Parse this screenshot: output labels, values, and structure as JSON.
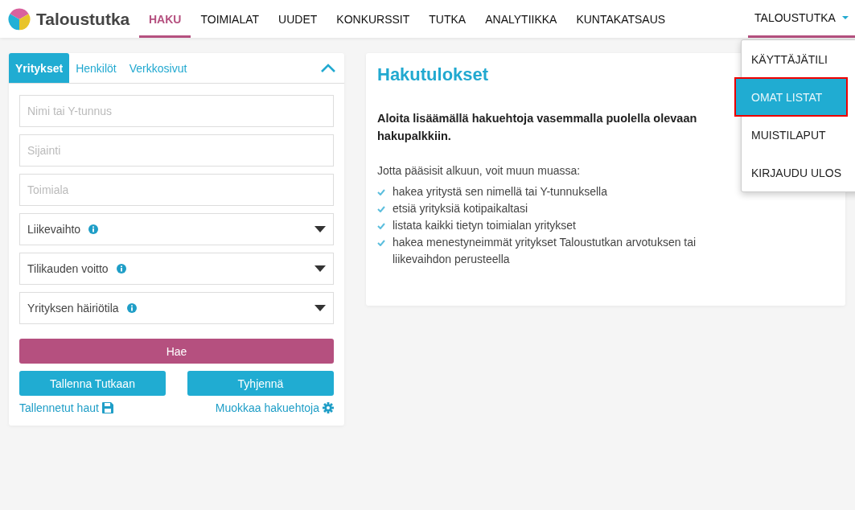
{
  "brand": {
    "name": "Taloustutka"
  },
  "nav": [
    {
      "label": "HAKU",
      "selected": true
    },
    {
      "label": "TOIMIALAT",
      "selected": false
    },
    {
      "label": "UUDET",
      "selected": false
    },
    {
      "label": "KONKURSSIT",
      "selected": false
    },
    {
      "label": "TUTKA",
      "selected": false
    },
    {
      "label": "ANALYTIIKKA",
      "selected": false
    },
    {
      "label": "KUNTAKATSAUS",
      "selected": false
    }
  ],
  "user_menu": {
    "label": "TALOUSTUTKA",
    "expanded": true,
    "items": [
      {
        "label": "KÄYTTÄJÄTILI",
        "selected": false,
        "highlighted": false
      },
      {
        "label": "OMAT LISTAT",
        "selected": true,
        "highlighted": true
      },
      {
        "label": "MUISTILAPUT",
        "selected": false,
        "highlighted": false
      },
      {
        "label": "KIRJAUDU ULOS",
        "selected": false,
        "highlighted": false
      }
    ]
  },
  "search_panel": {
    "tabs": [
      {
        "label": "Yritykset",
        "selected": true
      },
      {
        "label": "Henkilöt",
        "selected": false
      },
      {
        "label": "Verkkosivut",
        "selected": false
      }
    ],
    "collapsed": false,
    "fields": [
      {
        "kind": "text",
        "placeholder": "Nimi tai Y-tunnus"
      },
      {
        "kind": "text",
        "placeholder": "Sijainti"
      },
      {
        "kind": "text",
        "placeholder": "Toimiala"
      },
      {
        "kind": "select",
        "label": "Liikevaihto"
      },
      {
        "kind": "select",
        "label": "Tilikauden voitto"
      },
      {
        "kind": "select",
        "label": "Yrityksen häiriötila"
      }
    ],
    "search_button": "Hae",
    "save_button": "Tallenna Tutkaan",
    "clear_button": "Tyhjennä",
    "saved_link": "Tallennetut haut",
    "edit_link": "Muokkaa hakuehtoja"
  },
  "results": {
    "title": "Hakutulokset",
    "lead": "Aloita lisäämällä hakuehtoja vasemmalla puolella olevaan hakupalkkiin.",
    "intro": "Jotta pääsisit alkuun, voit muun muassa:",
    "tips": [
      "hakea yritystä sen nimellä tai Y-tunnuksella",
      "etsiä yrityksiä kotipaikaltasi",
      "listata kaikki tietyn toimialan yritykset",
      "hakea menestyneimmät yritykset Taloustutkan arvotuksen tai liikevaihdon perusteella"
    ]
  }
}
